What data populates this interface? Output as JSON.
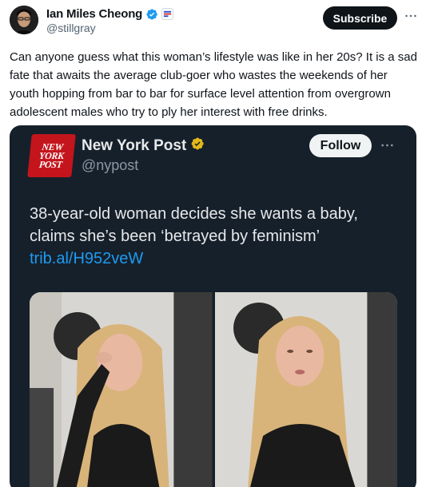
{
  "author": {
    "display_name": "Ian Miles Cheong",
    "handle": "@stillgray",
    "avatar_icon": "avatar",
    "verified_icon": "verified-badge-icon",
    "affiliate_icon": "affiliate-badge-icon"
  },
  "actions": {
    "subscribe_label": "Subscribe",
    "more_icon": "more-icon"
  },
  "tweet": {
    "text": "Can anyone guess what this woman’s lifestyle was like in her 20s? It is a sad fate that awaits the average club-goer who wastes the weekends of her youth hopping from bar to bar for surface level attention from overgrown adolescent males who try to ply her interest with free drinks."
  },
  "embedded": {
    "logo_lines": [
      "NEW",
      "YORK",
      "POST"
    ],
    "display_name": "New York Post",
    "handle": "@nypost",
    "follow_label": "Follow",
    "text_main": "38-year-old woman decides she wants a baby, claims she’s been ‘betrayed by feminism’ ",
    "text_link": "trib.al/H952veW",
    "verified_color": "#e2b719",
    "link_color": "#1d9bf0",
    "background_color": "#16202b"
  },
  "colors": {
    "subscribe_bg": "#0f1419",
    "verified_blue": "#1d9bf0",
    "nyp_red": "#c4151c"
  }
}
